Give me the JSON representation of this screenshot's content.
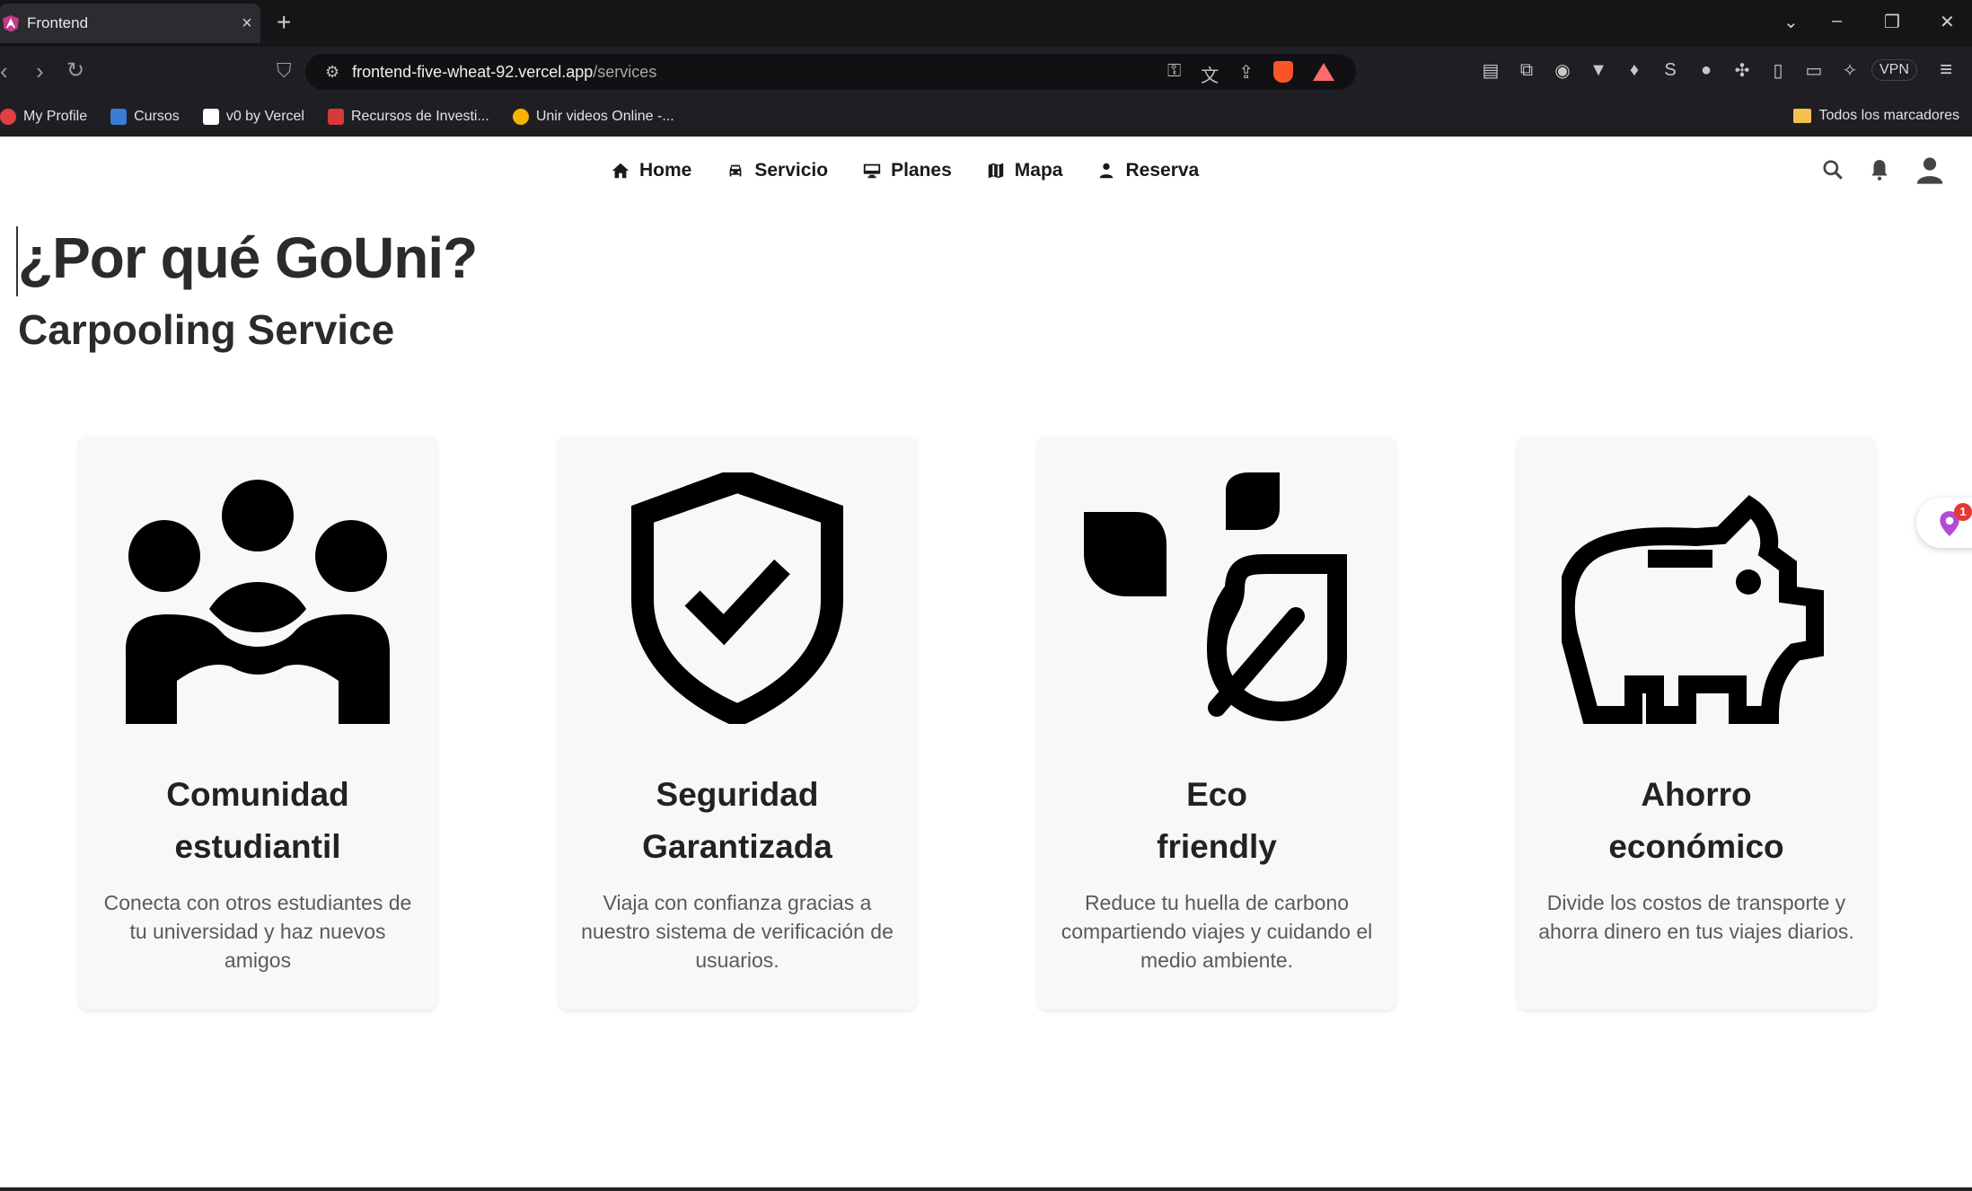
{
  "browser": {
    "tab_title": "Frontend",
    "tab_close": "×",
    "new_tab": "+",
    "url_host": "frontend-five-wheat-92.vercel.app",
    "url_path": "/services",
    "vpn_label": "VPN",
    "bookmarks": [
      {
        "label": "My Profile",
        "color": "#e04040"
      },
      {
        "label": "Cursos",
        "color": "#3a7bd5"
      },
      {
        "label": "v0 by Vercel",
        "color": "#ffffff"
      },
      {
        "label": "Recursos de Investi...",
        "color": "#d63a3a"
      },
      {
        "label": "Unir videos Online -...",
        "color": "#f4b400"
      }
    ],
    "all_bookmarks": "Todos los marcadores"
  },
  "nav": {
    "items": [
      {
        "label": "Home",
        "icon": "home-icon"
      },
      {
        "label": "Servicio",
        "icon": "car-icon"
      },
      {
        "label": "Planes",
        "icon": "monitor-icon"
      },
      {
        "label": "Mapa",
        "icon": "map-icon"
      },
      {
        "label": "Reserva",
        "icon": "person-icon"
      }
    ],
    "right_icons": [
      "search-icon",
      "bell-icon",
      "account-icon"
    ]
  },
  "hero": {
    "title": "¿Por qué GoUni?",
    "subtitle": "Carpooling Service"
  },
  "cards": [
    {
      "title_line1": "Comunidad",
      "title_line2": "estudiantil",
      "desc": "Conecta con otros estudiantes de tu universidad y haz nuevos amigos",
      "icon": "community-icon"
    },
    {
      "title_line1": "Seguridad",
      "title_line2": "Garantizada",
      "desc": "Viaja con confianza gracias a nuestro sistema de verificación de usuarios.",
      "icon": "shield-check-icon"
    },
    {
      "title_line1": "Eco",
      "title_line2": "friendly",
      "desc": "Reduce tu huella de carbono compartiendo viajes y cuidando el medio ambiente.",
      "icon": "eco-leaf-icon"
    },
    {
      "title_line1": "Ahorro",
      "title_line2": "económico",
      "desc": "Divide los costos de transporte y ahorra dinero en tus viajes diarios.",
      "icon": "piggy-bank-icon"
    }
  ],
  "floating_badge": "1"
}
